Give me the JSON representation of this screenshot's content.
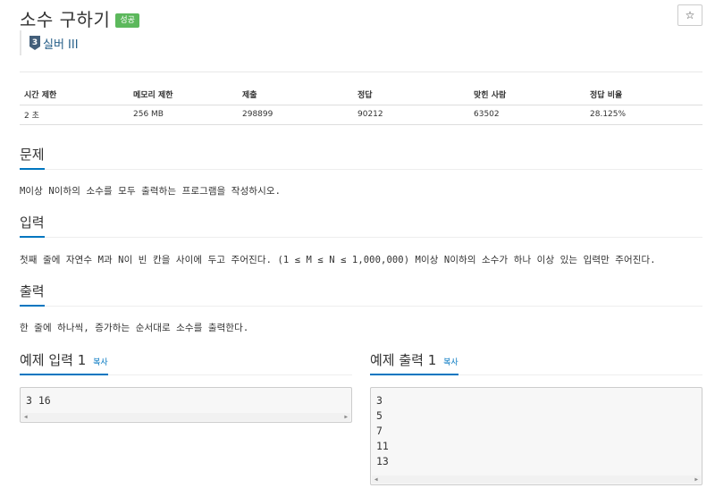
{
  "problem": {
    "title": "소수 구하기",
    "result_badge": "성공",
    "star": "☆",
    "tier_number": "3",
    "tier_label": "실버 III"
  },
  "info_table": {
    "headers": [
      "시간 제한",
      "메모리 제한",
      "제출",
      "정답",
      "맞힌 사람",
      "정답 비율"
    ],
    "values": [
      "2 초",
      "256 MB",
      "298899",
      "90212",
      "63502",
      "28.125%"
    ]
  },
  "sections": {
    "problem_heading": "문제",
    "problem_text": "M이상 N이하의 소수를 모두 출력하는 프로그램을 작성하시오.",
    "input_heading": "입력",
    "input_text": "첫째 줄에 자연수 M과 N이 빈 칸을 사이에 두고 주어진다. (1 ≤ M ≤ N ≤ 1,000,000) M이상 N이하의 소수가 하나 이상 있는 입력만 주어진다.",
    "output_heading": "출력",
    "output_text": "한 줄에 하나씩, 증가하는 순서대로 소수를 출력한다."
  },
  "sample_input": {
    "heading": "예제 입력 1",
    "copy_label": "복사",
    "lines": [
      "3 16"
    ]
  },
  "sample_output": {
    "heading": "예제 출력 1",
    "copy_label": "복사",
    "lines": [
      "3",
      "5",
      "7",
      "11",
      "13"
    ]
  },
  "colors": {
    "accent": "#0076c0",
    "success": "#5cb85c",
    "tier": "#255e88"
  }
}
